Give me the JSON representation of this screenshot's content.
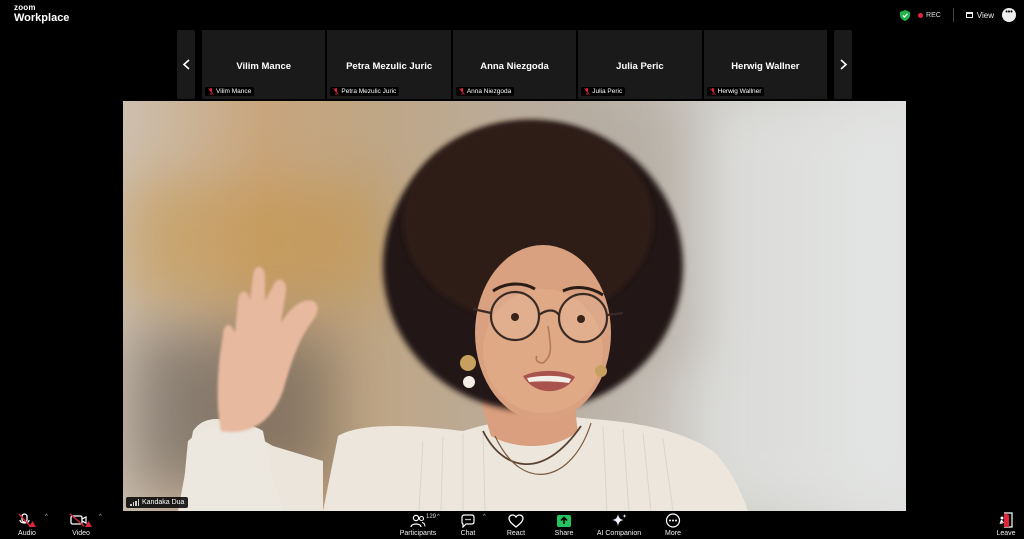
{
  "app": {
    "logo_line1": "zoom",
    "logo_line2": "Workplace"
  },
  "topbar": {
    "rec_label": "REC",
    "view_label": "View",
    "more_label": "•••",
    "shield_color": "#21b34b",
    "rec_color": "#e0243b"
  },
  "gallery": {
    "tiles": [
      {
        "display_name": "Vilim Mance",
        "label": "Vilim Mance"
      },
      {
        "display_name": "Petra Mezulic Juric",
        "label": "Petra Mezulic Juric"
      },
      {
        "display_name": "Anna Niezgoda",
        "label": "Anna Niezgoda"
      },
      {
        "display_name": "Julia Peric",
        "label": "Julia Peric"
      },
      {
        "display_name": "Herwig Wallner",
        "label": "Herwig Wallner"
      }
    ]
  },
  "main_video": {
    "speaker_name": "Kandaka Dua"
  },
  "toolbar": {
    "audio_label": "Audio",
    "video_label": "Video",
    "participants_label": "Participants",
    "participants_count": "129",
    "chat_label": "Chat",
    "react_label": "React",
    "share_label": "Share",
    "ai_label": "AI Companion",
    "more_label": "More",
    "leave_label": "Leave",
    "share_color": "#22c55e",
    "muted_color": "#e0243b"
  }
}
